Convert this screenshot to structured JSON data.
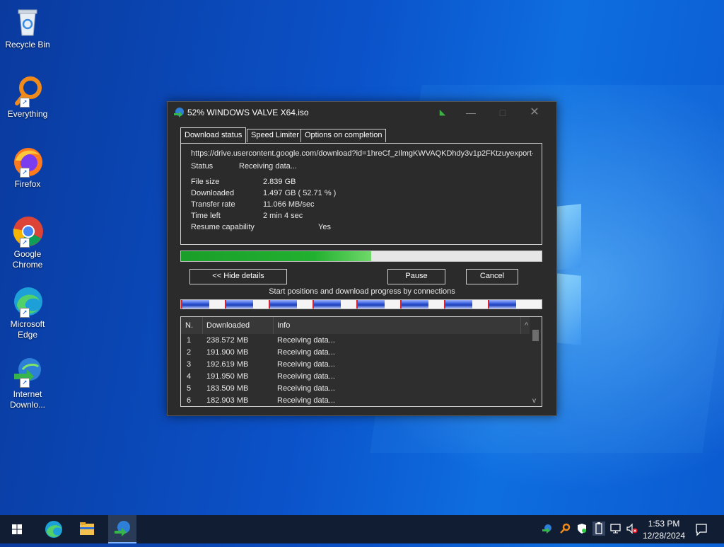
{
  "desktop": {
    "icons": [
      {
        "label": "Recycle Bin",
        "icon": "recycle-bin-icon"
      },
      {
        "label": "Everything",
        "icon": "everything-search-icon"
      },
      {
        "label": "Firefox",
        "icon": "firefox-icon"
      },
      {
        "label": "Google Chrome",
        "icon": "chrome-icon"
      },
      {
        "label": "Microsoft Edge",
        "icon": "edge-icon"
      },
      {
        "label": "Internet Downlo...",
        "icon": "idm-icon"
      }
    ]
  },
  "window": {
    "title": "52% WINDOWS VALVE X64.iso",
    "tabs": [
      "Download status",
      "Speed Limiter",
      "Options on completion"
    ],
    "active_tab": 0,
    "url": "https://drive.usercontent.google.com/download?id=1hreCf_zIlmgKWVAQKDhdy3v1p2FKtzuyexport-",
    "status_label": "Status",
    "status_value": "Receiving data...",
    "file_size_label": "File size",
    "file_size_value": "2.839  GB",
    "downloaded_label": "Downloaded",
    "downloaded_value": "1.497  GB  ( 52.71 % )",
    "rate_label": "Transfer rate",
    "rate_value": "11.066  MB/sec",
    "time_left_label": "Time left",
    "time_left_value": "2 min 4 sec",
    "resume_label": "Resume capability",
    "resume_value": "Yes",
    "progress_percent": 52.71,
    "buttons": {
      "hide_details": "<< Hide details",
      "pause": "Pause",
      "cancel": "Cancel"
    },
    "connections_caption": "Start positions and download progress by connections",
    "table": {
      "headers": [
        "N.",
        "Downloaded",
        "Info"
      ],
      "rows": [
        {
          "n": "1",
          "downloaded": "238.572  MB",
          "info": "Receiving data..."
        },
        {
          "n": "2",
          "downloaded": "191.900  MB",
          "info": "Receiving data..."
        },
        {
          "n": "3",
          "downloaded": "192.619  MB",
          "info": "Receiving data..."
        },
        {
          "n": "4",
          "downloaded": "191.950  MB",
          "info": "Receiving data..."
        },
        {
          "n": "5",
          "downloaded": "183.509  MB",
          "info": "Receiving data..."
        },
        {
          "n": "6",
          "downloaded": "182.903  MB",
          "info": "Receiving data..."
        }
      ]
    }
  },
  "taskbar": {
    "start_icon": "windows-start-icon",
    "pinned": [
      "edge-icon",
      "file-explorer-icon",
      "idm-icon"
    ],
    "tray_icons": [
      "idm-tray-icon",
      "everything-tray-icon",
      "security-shield-icon",
      "usb-icon",
      "network-icon",
      "volume-muted-icon"
    ],
    "time": "1:53 PM",
    "date": "12/28/2024",
    "notification_icon": "notification-icon"
  }
}
